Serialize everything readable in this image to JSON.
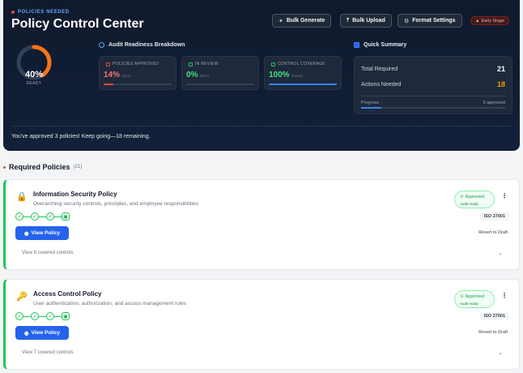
{
  "header": {
    "eyebrow": "POLICIES NEEDED",
    "title": "Policy Control Center",
    "buttons": [
      {
        "label": "Bulk Generate",
        "icon": "sparkles-icon"
      },
      {
        "label": "Bulk Upload",
        "icon": "upload-icon"
      },
      {
        "label": "Format Settings",
        "icon": "gear-icon"
      }
    ],
    "stage_badge": "Early Stage"
  },
  "readiness": {
    "percent": "40%",
    "percent_value": 40,
    "label": "READY"
  },
  "audit": {
    "heading": "Audit Readiness Breakdown",
    "metrics": [
      {
        "label": "POLICIES APPROVED",
        "value": "14%",
        "sub": "(3/21)",
        "fill": 14,
        "color": "#ef4444"
      },
      {
        "label": "IN REVIEW",
        "value": "0%",
        "sub": "(0/21)",
        "fill": 0,
        "color": "#22c55e"
      },
      {
        "label": "CONTROL COVERAGE",
        "value": "100%",
        "sub": "(64/64)",
        "fill": 100,
        "color": "#22c55e"
      }
    ]
  },
  "summary": {
    "heading": "Quick Summary",
    "total_label": "Total Required",
    "total_value": "21",
    "needed_label": "Actions Needed",
    "needed_value": "18",
    "progress_label": "Progress",
    "progress_value": "3 approved",
    "progress_fill": 14
  },
  "encouragement": "You've approved 3 policies! Keep going—18 remaining.",
  "policies_section": {
    "heading": "Required Policies",
    "count": "(21)"
  },
  "policies": [
    {
      "title": "Information Security Policy",
      "description": "Overarching security controls, principles, and employee responsibilities",
      "icon": "lock-icon",
      "status": "Approved",
      "status_sub": "Audit ready",
      "framework": "ISO 27001",
      "view_label": "View Policy",
      "revert_label": "Revert to Draft",
      "covered": "View 8 covered controls"
    },
    {
      "title": "Access Control Policy",
      "description": "User authentication, authorization, and access management rules",
      "icon": "key-icon",
      "status": "Approved",
      "status_sub": "Audit ready",
      "framework": "ISO 27001",
      "view_label": "View Policy",
      "revert_label": "Revert to Draft",
      "covered": "View 7 covered controls"
    }
  ]
}
